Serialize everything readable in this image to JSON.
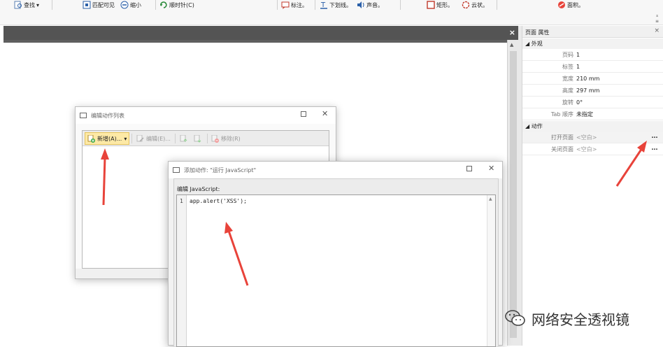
{
  "ribbon": {
    "items": [
      {
        "label": "查找",
        "icon": "find-icon",
        "suffix": "▾"
      },
      {
        "label": "匹配可见",
        "icon": "fit-visible-icon"
      },
      {
        "label": "缩小",
        "icon": "zoom-out-icon"
      },
      {
        "label": "顺时针(C)",
        "icon": "rotate-clockwise-icon"
      },
      {
        "label": "标注。",
        "icon": "callout-icon"
      },
      {
        "label": "下划线。",
        "icon": "underline-icon"
      },
      {
        "label": "声音。",
        "icon": "sound-icon"
      },
      {
        "label": "矩形。",
        "icon": "rectangle-icon"
      },
      {
        "label": "云状。",
        "icon": "cloud-icon"
      },
      {
        "label": "面积。",
        "icon": "area-icon"
      }
    ]
  },
  "properties_panel": {
    "title": "页面 属性",
    "close": "×",
    "sections": [
      {
        "title": "◢ 外观",
        "rows": [
          {
            "key": "页码",
            "value": "1"
          },
          {
            "key": "标签",
            "value": "1"
          },
          {
            "key": "宽度",
            "value": "210 mm"
          },
          {
            "key": "高度",
            "value": "297 mm"
          },
          {
            "key": "旋转",
            "value": "0°"
          },
          {
            "key": "Tab 顺序",
            "value": "未指定"
          }
        ]
      },
      {
        "title": "◢ 动作",
        "rows": [
          {
            "key": "打开页面",
            "value": "<空白>",
            "button": "…"
          },
          {
            "key": "关闭页面",
            "value": "<空白>",
            "button": "…"
          }
        ]
      }
    ]
  },
  "doc_tab": {
    "close": "×"
  },
  "dialog_action_list": {
    "title": "编辑动作列表",
    "toolbar": {
      "new_label": "新增(A)...",
      "new_dropdown": "▾",
      "edit_label": "编辑(E)...",
      "remove_label": "移除(R)"
    }
  },
  "dialog_add_action": {
    "title": "添加动作: \"运行 JavaScript\"",
    "editor_label": "编辑 JavaScript:",
    "line_number": "1",
    "code": "app.alert('XSS');"
  },
  "watermark": {
    "text": "网络安全透视镜",
    "icon": "wechat-icon"
  },
  "colors": {
    "arrow": "#e8433a",
    "doc_bar": "#545454",
    "primary_button": "#fde9a6"
  }
}
